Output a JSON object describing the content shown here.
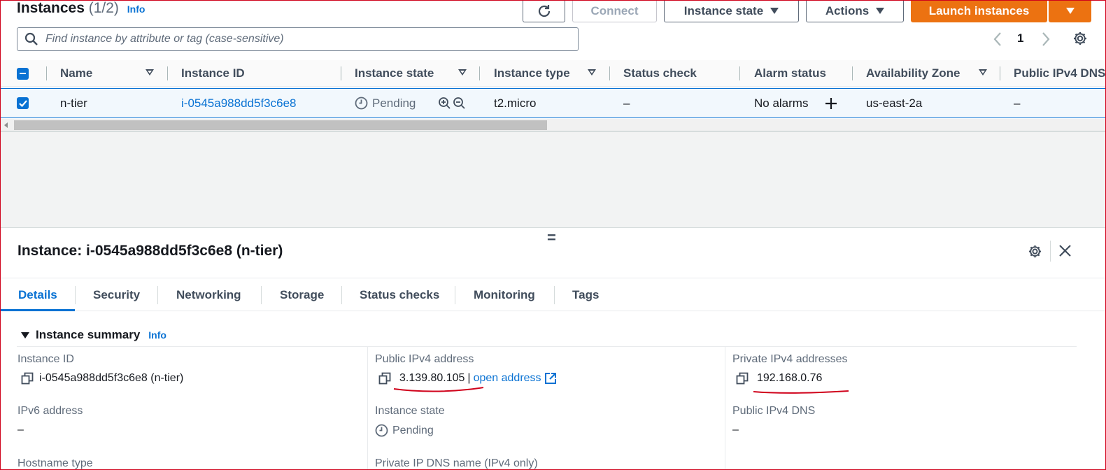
{
  "header": {
    "title": "Instances",
    "count": "(1/2)",
    "info": "Info",
    "buttons": {
      "connect": "Connect",
      "instance_state": "Instance state",
      "actions": "Actions",
      "launch": "Launch instances"
    }
  },
  "search": {
    "placeholder": "Find instance by attribute or tag (case-sensitive)"
  },
  "pagination": {
    "page": "1"
  },
  "table": {
    "columns": [
      "Name",
      "Instance ID",
      "Instance state",
      "Instance type",
      "Status check",
      "Alarm status",
      "Availability Zone",
      "Public IPv4 DNS"
    ],
    "row": {
      "name": "n-tier",
      "instance_id": "i-0545a988dd5f3c6e8",
      "state": "Pending",
      "type": "t2.micro",
      "status_check": "–",
      "alarm": "No alarms",
      "az": "us-east-2a",
      "dns": "–"
    }
  },
  "detail": {
    "resize_handle": "=",
    "title": "Instance: i-0545a988dd5f3c6e8 (n-tier)",
    "tabs": [
      "Details",
      "Security",
      "Networking",
      "Storage",
      "Status checks",
      "Monitoring",
      "Tags"
    ],
    "summary_title": "Instance summary",
    "summary_info": "Info",
    "fields": {
      "instance_id_label": "Instance ID",
      "instance_id_value": "i-0545a988dd5f3c6e8 (n-tier)",
      "public_ip_label": "Public IPv4 address",
      "public_ip_value": "3.139.80.105",
      "public_ip_sep": "|",
      "open_address": "open address",
      "private_ip_label": "Private IPv4 addresses",
      "private_ip_value": "192.168.0.76",
      "ipv6_label": "IPv6 address",
      "ipv6_value": "–",
      "state_label": "Instance state",
      "state_value": "Pending",
      "public_dns_label": "Public IPv4 DNS",
      "public_dns_value": "–",
      "hostname_label": "Hostname type",
      "private_dns_label": "Private IP DNS name (IPv4 only)"
    }
  },
  "colors": {
    "accent": "#0972d3",
    "primary_button": "#ec7211",
    "annotation": "#d0021b"
  }
}
